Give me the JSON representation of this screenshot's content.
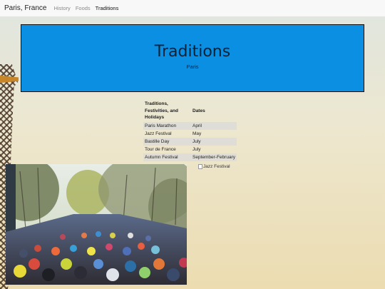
{
  "navbar": {
    "brand": "Paris, France",
    "links": [
      {
        "label": "History",
        "active": false
      },
      {
        "label": "Foods",
        "active": false
      },
      {
        "label": "Traditions",
        "active": true
      }
    ]
  },
  "hero": {
    "title": "Traditions",
    "subtitle": "Paris",
    "background_color": "#0a8fe3"
  },
  "table": {
    "headers": [
      "Traditions, Festivities, and Holidays",
      "Dates"
    ],
    "rows": [
      [
        "Paris Marathon",
        "April"
      ],
      [
        "Jazz Festival",
        "May"
      ],
      [
        "Bastille Day",
        "July"
      ],
      [
        "Tour de France",
        "July"
      ],
      [
        "Autumn Festival",
        "September-February"
      ]
    ]
  },
  "images": {
    "marathon_photo": "marathon-crowd-photo",
    "jazz_alt": "Jazz Festival"
  }
}
